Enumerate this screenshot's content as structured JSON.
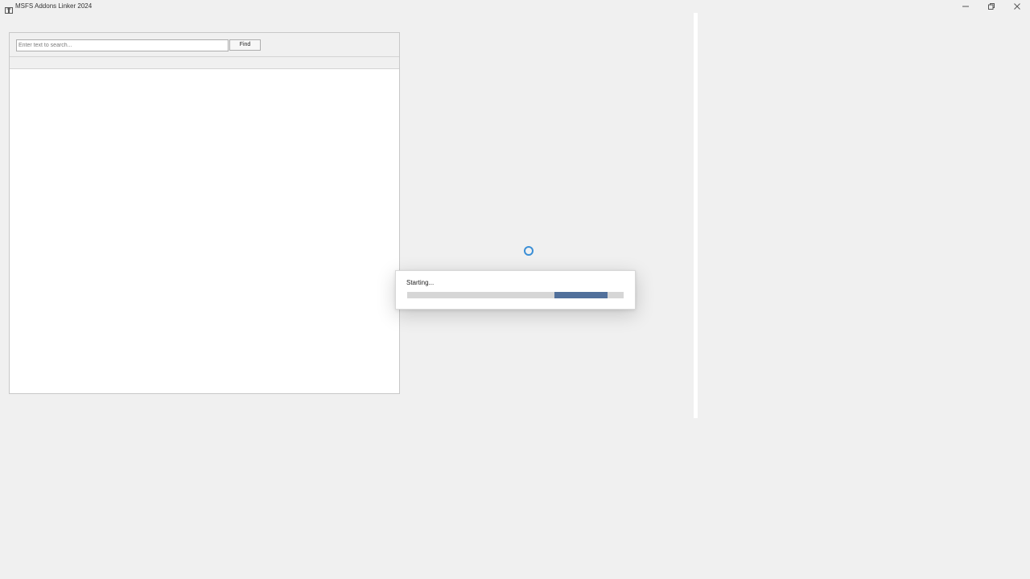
{
  "window": {
    "title": "MSFS Addons Linker 2024",
    "icon": "app-icon",
    "controls": {
      "minimize_icon": "minimize-icon",
      "maximize_icon": "restore-icon",
      "close_icon": "close-icon"
    }
  },
  "search": {
    "placeholder": "Enter text to search...",
    "value": "",
    "find_label": "Find"
  },
  "loading": {
    "status_text": "Starting...",
    "spinner_icon": "loading-spinner-icon",
    "progress": {
      "mode": "indeterminate",
      "segment_start": 0.68,
      "segment_end": 0.925
    }
  },
  "colors": {
    "background": "#f0f0f0",
    "progress_fill": "#51709b",
    "progress_track": "#d6d6d6",
    "spinner": "#3b8fd6"
  }
}
